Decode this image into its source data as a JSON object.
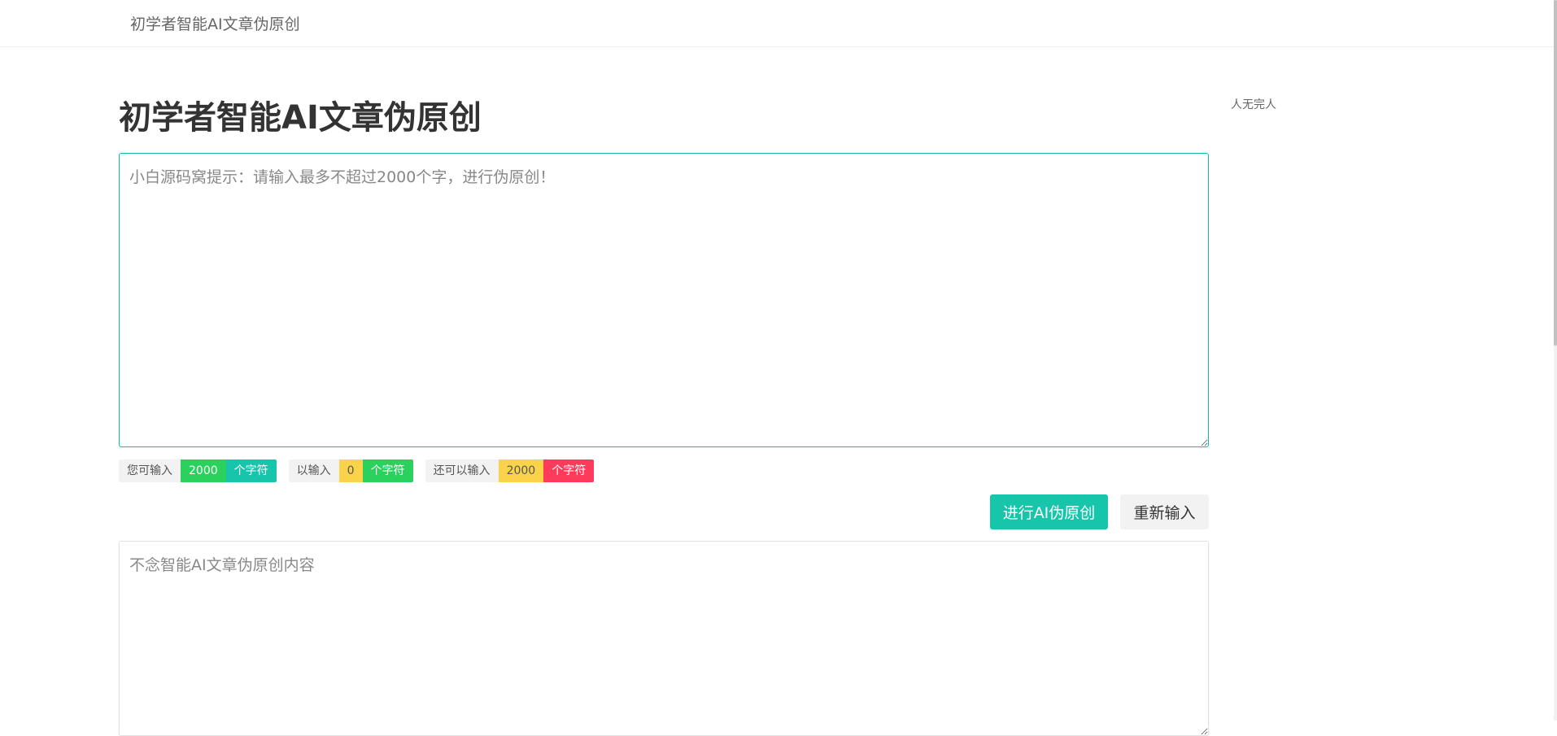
{
  "header": {
    "brand": "初学者智能AI文章伪原创"
  },
  "main": {
    "title": "初学者智能AI文章伪原创",
    "input_placeholder": "小白源码窝提示：请输入最多不超过2000个字，进行伪原创！",
    "output_placeholder": "不念智能AI文章伪原创内容"
  },
  "side": {
    "note": "人无完人"
  },
  "counters": [
    {
      "label": "您可输入",
      "value": "2000",
      "unit": "个字符"
    },
    {
      "label": "以输入",
      "value": "0",
      "unit": "个字符"
    },
    {
      "label": "还可以输入",
      "value": "2000",
      "unit": "个字符"
    }
  ],
  "actions": {
    "submit_label": "进行AI伪原创",
    "reset_label": "重新输入"
  },
  "colors": {
    "accent": "#16c5aa",
    "green": "#2bd15d",
    "yellow": "#fbd34a",
    "red": "#ff3b5c"
  }
}
